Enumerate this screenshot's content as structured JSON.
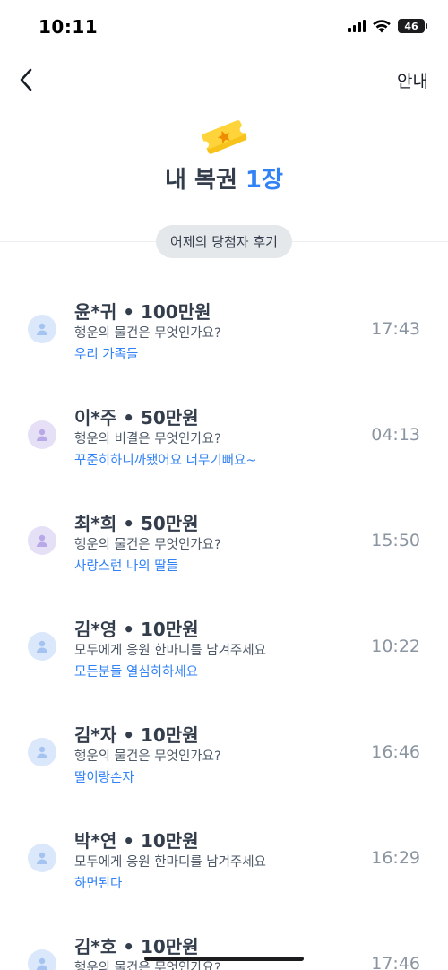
{
  "status_bar": {
    "time": "10:11",
    "battery": "46"
  },
  "nav": {
    "back_icon": "chevron-left-icon",
    "guide_label": "안내"
  },
  "header": {
    "icon": "ticket-icon",
    "title_prefix": "내 복권",
    "title_count": "1장"
  },
  "section": {
    "chip_label": "어제의 당첨자 후기"
  },
  "reviews": [
    {
      "name": "윤*귀 • 100만원",
      "question": "행운의 물건은 무엇인가요?",
      "answer": "우리 가족들",
      "time": "17:43",
      "avatar_color": "blue"
    },
    {
      "name": "이*주 • 50만원",
      "question": "행운의 비결은 무엇인가요?",
      "answer": "꾸준히하니까됐어요 너무기뻐요~",
      "time": "04:13",
      "avatar_color": "purple"
    },
    {
      "name": "최*희 • 50만원",
      "question": "행운의 물건은 무엇인가요?",
      "answer": "사랑스런 나의 딸들",
      "time": "15:50",
      "avatar_color": "purple"
    },
    {
      "name": "김*영 • 10만원",
      "question": "모두에게 응원 한마디를 남겨주세요",
      "answer": "모든분들 열심히하세요",
      "time": "10:22",
      "avatar_color": "blue"
    },
    {
      "name": "김*자 • 10만원",
      "question": "행운의 물건은 무엇인가요?",
      "answer": "딸이랑손자",
      "time": "16:46",
      "avatar_color": "blue"
    },
    {
      "name": "박*연 • 10만원",
      "question": "모두에게 응원 한마디를 남겨주세요",
      "answer": "하면된다",
      "time": "16:29",
      "avatar_color": "blue"
    },
    {
      "name": "김*호 • 10만원",
      "question": "행운의 물건은 무엇인가요?",
      "answer": "",
      "time": "17:46",
      "avatar_color": "blue"
    }
  ]
}
